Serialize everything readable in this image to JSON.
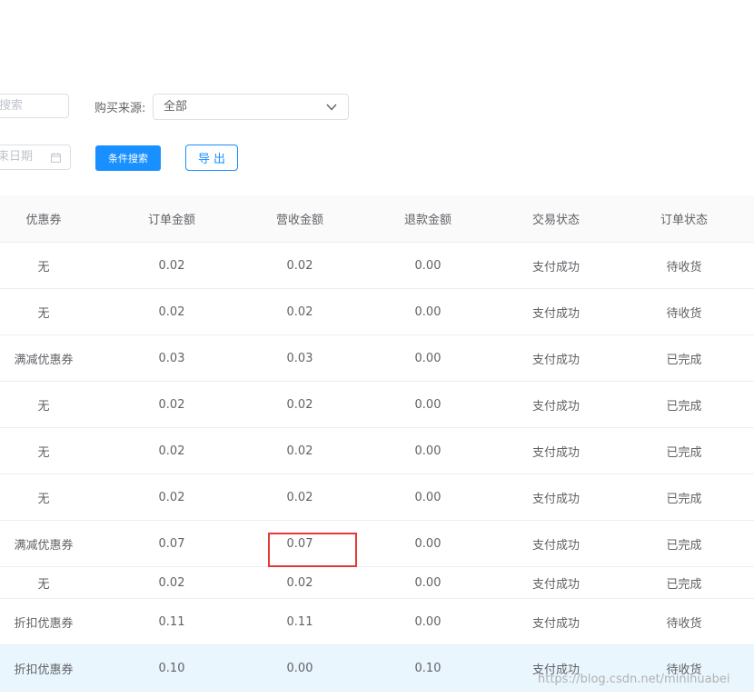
{
  "filters": {
    "search_placeholder": "搜索",
    "source_label": "购买来源:",
    "source_value": "全部",
    "end_date_placeholder": "束日期",
    "search_button": "条件搜索",
    "export_button": "导出"
  },
  "table": {
    "headers": [
      "优惠券",
      "订单金额",
      "营收金额",
      "退款金额",
      "交易状态",
      "订单状态"
    ],
    "rows": [
      [
        "无",
        "0.02",
        "0.02",
        "0.00",
        "支付成功",
        "待收货"
      ],
      [
        "无",
        "0.02",
        "0.02",
        "0.00",
        "支付成功",
        "待收货"
      ],
      [
        "满减优惠券",
        "0.03",
        "0.03",
        "0.00",
        "支付成功",
        "已完成"
      ],
      [
        "无",
        "0.02",
        "0.02",
        "0.00",
        "支付成功",
        "已完成"
      ],
      [
        "无",
        "0.02",
        "0.02",
        "0.00",
        "支付成功",
        "已完成"
      ],
      [
        "无",
        "0.02",
        "0.02",
        "0.00",
        "支付成功",
        "已完成"
      ],
      [
        "满减优惠券",
        "0.07",
        "0.07",
        "0.00",
        "支付成功",
        "已完成"
      ],
      [
        "无",
        "0.02",
        "0.02",
        "0.00",
        "支付成功",
        "已完成"
      ],
      [
        "折扣优惠券",
        "0.11",
        "0.11",
        "0.00",
        "支付成功",
        "待收货"
      ],
      [
        "折扣优惠券",
        "0.10",
        "0.00",
        "0.10",
        "支付成功",
        "待收货"
      ]
    ]
  },
  "watermark": "https://blog.csdn.net/minihuabei",
  "colors": {
    "primary": "#1890ff",
    "highlight_row": "#e9f6fd",
    "annotation_box": "#e53935"
  }
}
